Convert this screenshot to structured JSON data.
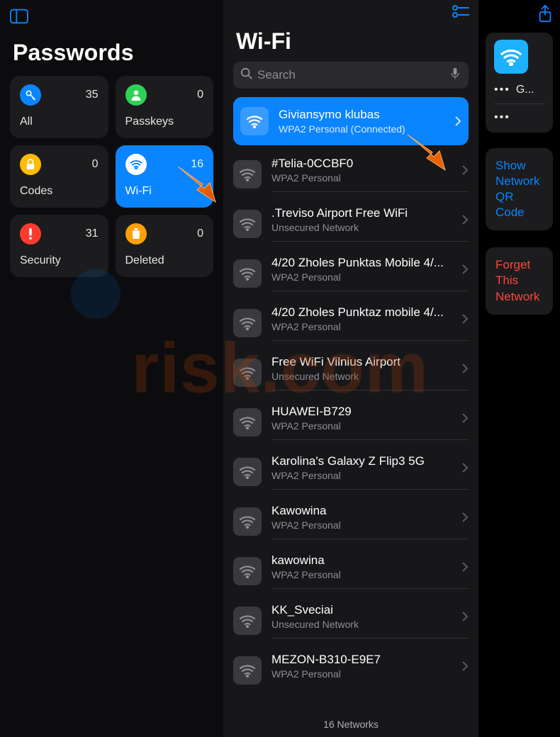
{
  "sidebar": {
    "title": "Passwords",
    "categories": [
      {
        "id": "all",
        "label": "All",
        "count": 35,
        "color": "#0a84ff",
        "icon": "key"
      },
      {
        "id": "passkeys",
        "label": "Passkeys",
        "count": 0,
        "color": "#30d158",
        "icon": "person"
      },
      {
        "id": "codes",
        "label": "Codes",
        "count": 0,
        "color": "#ffbc00",
        "icon": "lock"
      },
      {
        "id": "wifi",
        "label": "Wi-Fi",
        "count": 16,
        "color": "#ffffff",
        "icon": "wifi",
        "active": true
      },
      {
        "id": "security",
        "label": "Security",
        "count": 31,
        "color": "#ff3b30",
        "icon": "alert"
      },
      {
        "id": "deleted",
        "label": "Deleted",
        "count": 0,
        "color": "#ff9f0a",
        "icon": "trash"
      }
    ]
  },
  "main": {
    "title": "Wi-Fi",
    "search_placeholder": "Search",
    "footer": "16 Networks",
    "networks": [
      {
        "name": "Giviansymo klubas",
        "sub": "WPA2 Personal (Connected)",
        "selected": true
      },
      {
        "name": "#Telia-0CCBF0",
        "sub": "WPA2 Personal"
      },
      {
        "name": ".Treviso Airport Free WiFi",
        "sub": "Unsecured Network"
      },
      {
        "name": "4/20 Zholes Punktas Mobile 4/...",
        "sub": "WPA2 Personal"
      },
      {
        "name": "4/20 Zholes Punktaz mobile 4/...",
        "sub": "WPA2 Personal"
      },
      {
        "name": "Free WiFi Vilnius Airport",
        "sub": "Unsecured Network"
      },
      {
        "name": "HUAWEI-B729",
        "sub": "WPA2 Personal"
      },
      {
        "name": "Karolina's Galaxy Z Flip3 5G",
        "sub": "WPA2 Personal"
      },
      {
        "name": "Kawowina",
        "sub": "WPA2 Personal"
      },
      {
        "name": "kawowina",
        "sub": "WPA2 Personal"
      },
      {
        "name": "KK_Sveciai",
        "sub": "Unsecured Network"
      },
      {
        "name": "MEZON-B310-E9E7",
        "sub": "WPA2 Personal"
      }
    ]
  },
  "detail": {
    "field1_dots": "•••",
    "field1_text": "G...",
    "field2_dots": "•••",
    "action_qr": "Show Network QR Code",
    "action_forget": "Forget This Network"
  },
  "watermark": "risk.com"
}
